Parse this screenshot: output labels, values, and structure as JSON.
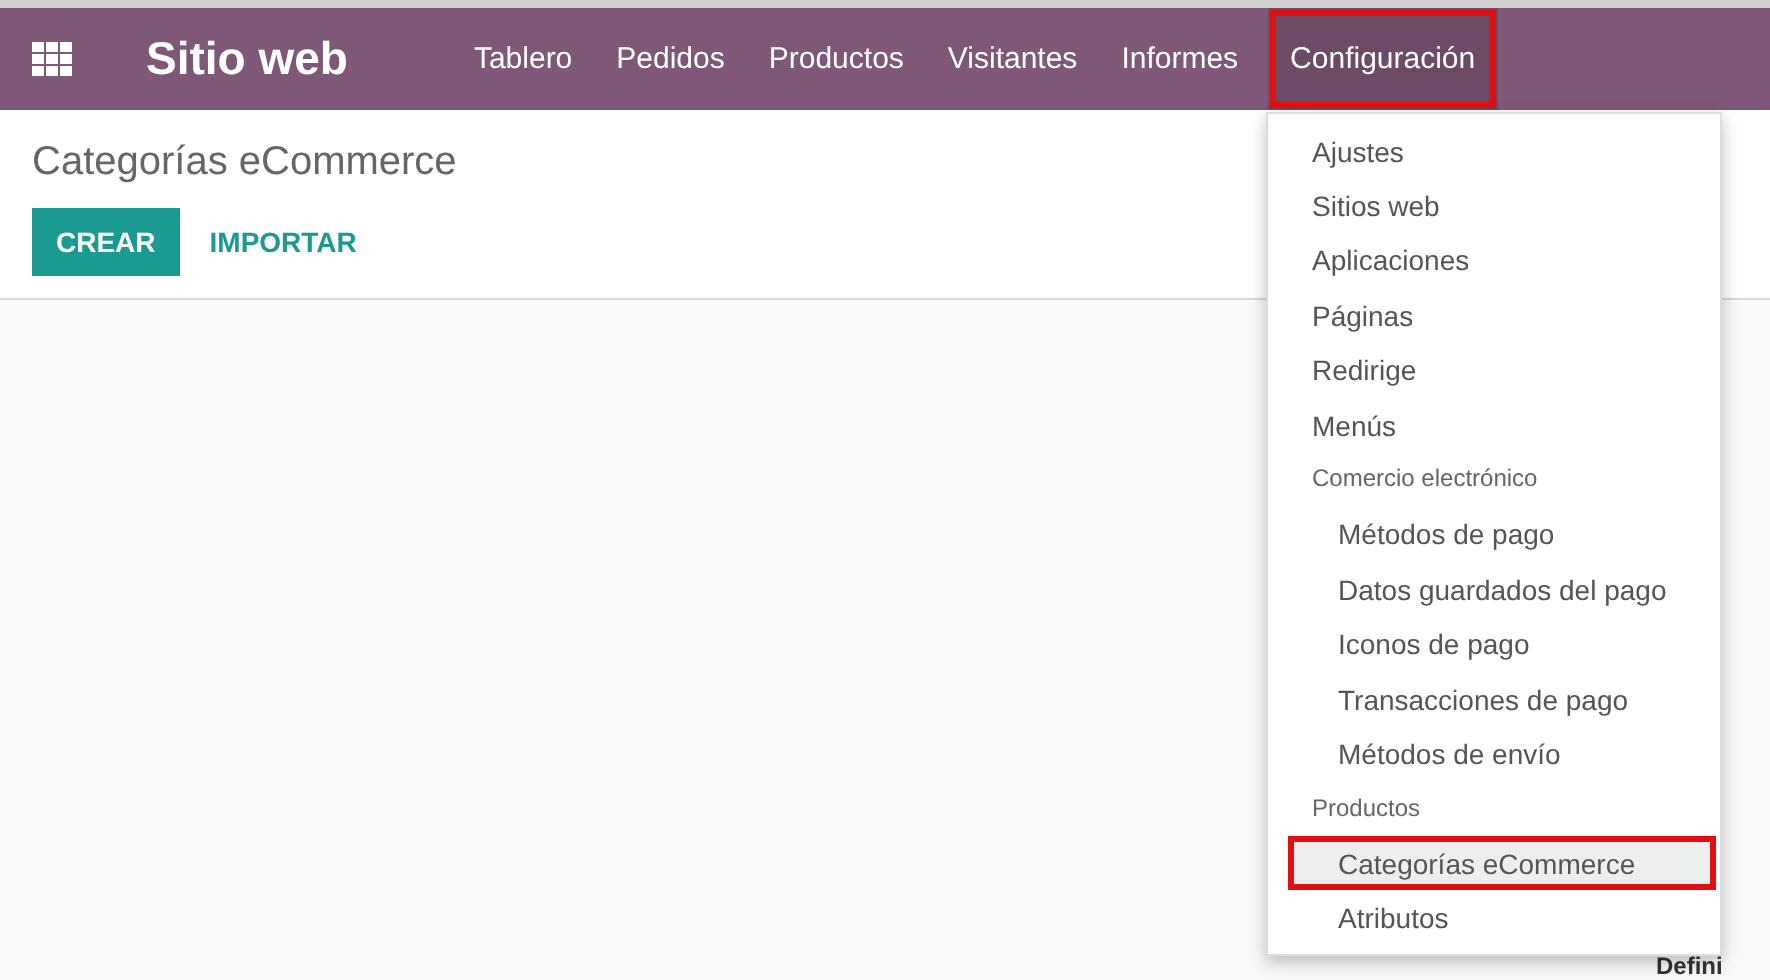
{
  "navbar": {
    "app_title": "Sitio web",
    "menu": [
      {
        "label": "Tablero",
        "selected": false,
        "highlighted": false
      },
      {
        "label": "Pedidos",
        "selected": false,
        "highlighted": false
      },
      {
        "label": "Productos",
        "selected": false,
        "highlighted": false
      },
      {
        "label": "Visitantes",
        "selected": false,
        "highlighted": false
      },
      {
        "label": "Informes",
        "selected": false,
        "highlighted": false
      },
      {
        "label": "Configuración",
        "selected": true,
        "highlighted": true
      }
    ]
  },
  "control_panel": {
    "title": "Categorías eCommerce",
    "buttons": [
      {
        "label": "CREAR",
        "kind": "primary"
      },
      {
        "label": "IMPORTAR",
        "kind": "link"
      }
    ]
  },
  "dropdown": {
    "items": [
      {
        "kind": "item",
        "label": "Ajustes",
        "selected": false,
        "highlighted": false
      },
      {
        "kind": "item",
        "label": "Sitios web",
        "selected": false,
        "highlighted": false
      },
      {
        "kind": "item",
        "label": "Aplicaciones",
        "selected": false,
        "highlighted": false
      },
      {
        "kind": "item",
        "label": "Páginas",
        "selected": false,
        "highlighted": false
      },
      {
        "kind": "item",
        "label": "Redirige",
        "selected": false,
        "highlighted": false
      },
      {
        "kind": "item",
        "label": "Menús",
        "selected": false,
        "highlighted": false
      },
      {
        "kind": "header",
        "label": "Comercio electrónico"
      },
      {
        "kind": "subitem",
        "label": "Métodos de pago",
        "selected": false,
        "highlighted": false
      },
      {
        "kind": "subitem",
        "label": "Datos guardados del pago",
        "selected": false,
        "highlighted": false
      },
      {
        "kind": "subitem",
        "label": "Iconos de pago",
        "selected": false,
        "highlighted": false
      },
      {
        "kind": "subitem",
        "label": "Transacciones de pago",
        "selected": false,
        "highlighted": false
      },
      {
        "kind": "subitem",
        "label": "Métodos de envío",
        "selected": false,
        "highlighted": false
      },
      {
        "kind": "header",
        "label": "Productos"
      },
      {
        "kind": "subitem",
        "label": "Categorías eCommerce",
        "selected": true,
        "highlighted": true
      },
      {
        "kind": "subitem",
        "label": "Atributos",
        "selected": false,
        "highlighted": false
      }
    ]
  },
  "background_text": "Defini"
}
